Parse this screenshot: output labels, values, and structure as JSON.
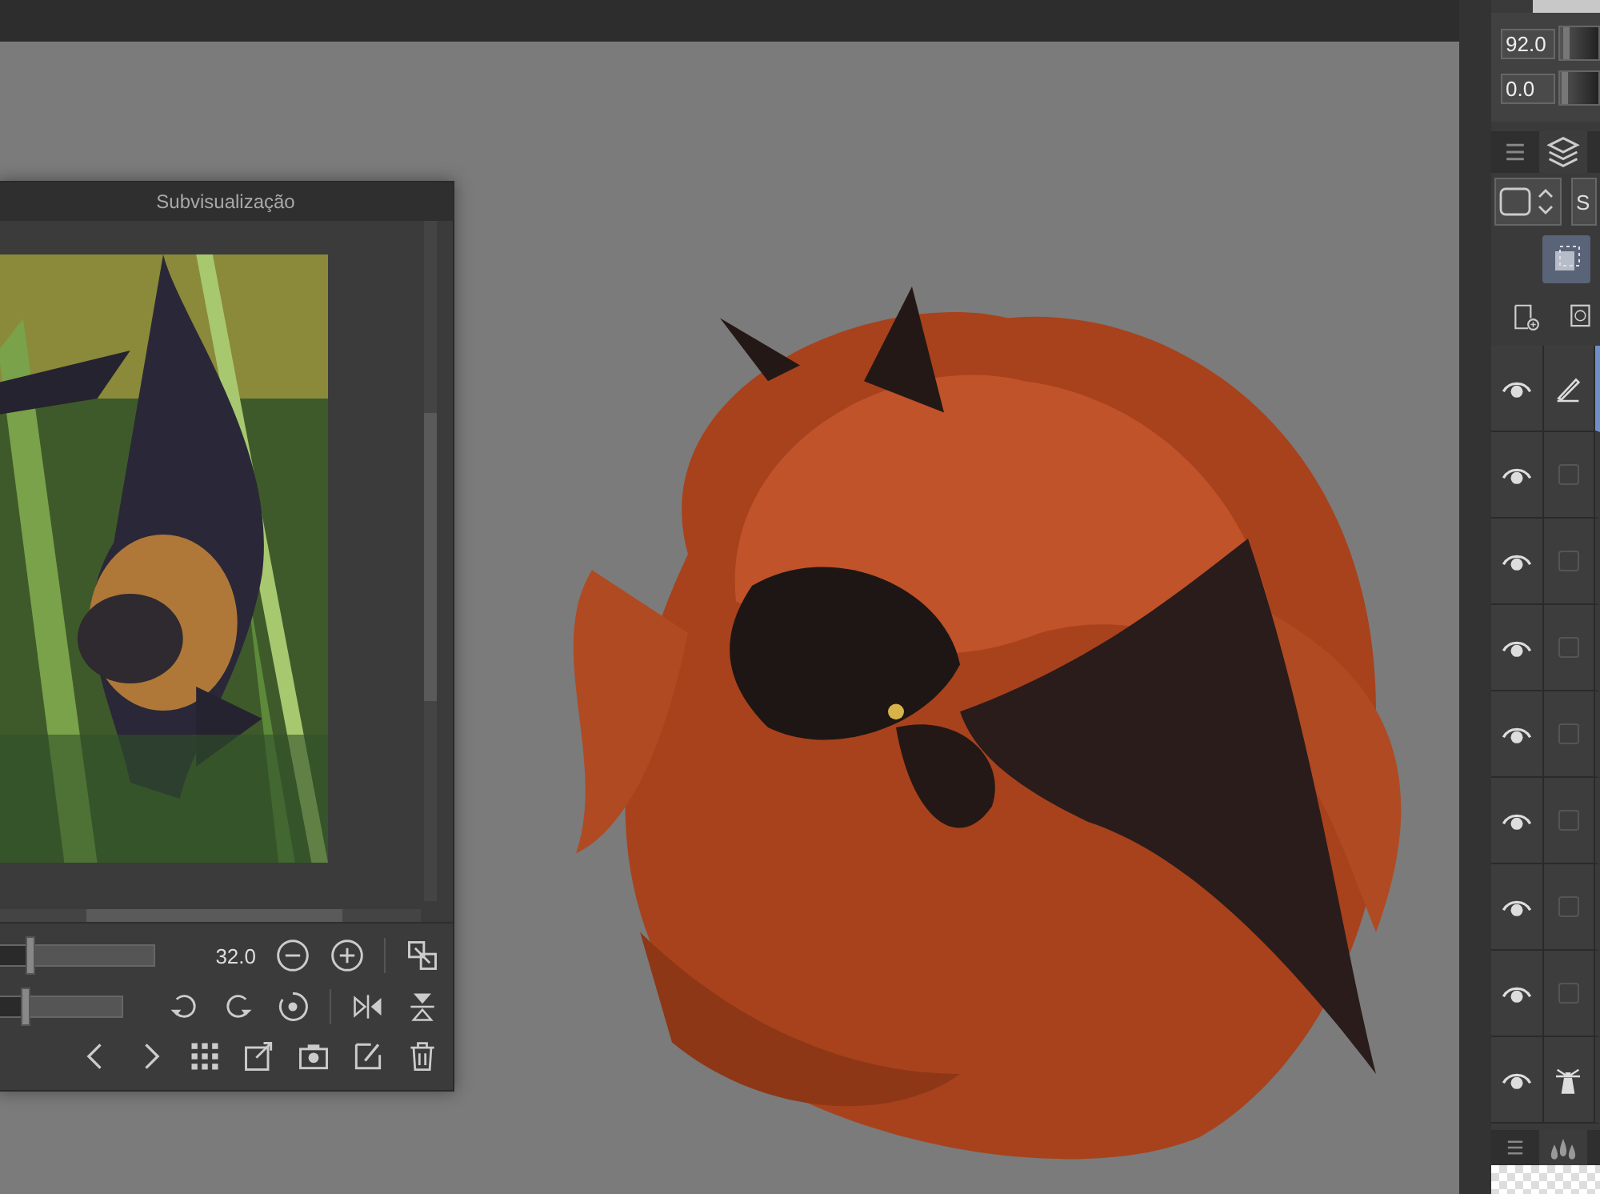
{
  "subview": {
    "title": "Subvisualização",
    "zoom": {
      "reading": "32.0",
      "level": 0.2
    },
    "rotation": {
      "level": 0.22
    }
  },
  "properties": {
    "sliders": [
      {
        "reading": "92.0",
        "level": 0.1
      },
      {
        "reading": "0.0",
        "level": 0.05
      }
    ]
  },
  "layers_panel": {
    "tabs": [
      {
        "kind": "menu",
        "selected": false
      },
      {
        "kind": "layers",
        "selected": true
      }
    ],
    "mode_label": "S",
    "layers": [
      {
        "kind": "editing",
        "visible": true,
        "selected": true
      },
      {
        "kind": "plain",
        "visible": true,
        "selected": false
      },
      {
        "kind": "plain",
        "visible": true,
        "selected": false
      },
      {
        "kind": "plain",
        "visible": true,
        "selected": false
      },
      {
        "kind": "plain",
        "visible": true,
        "selected": false
      },
      {
        "kind": "plain",
        "visible": true,
        "selected": false
      },
      {
        "kind": "plain",
        "visible": true,
        "selected": false
      },
      {
        "kind": "plain",
        "visible": true,
        "selected": false
      },
      {
        "kind": "reference",
        "visible": true,
        "selected": false
      }
    ]
  }
}
